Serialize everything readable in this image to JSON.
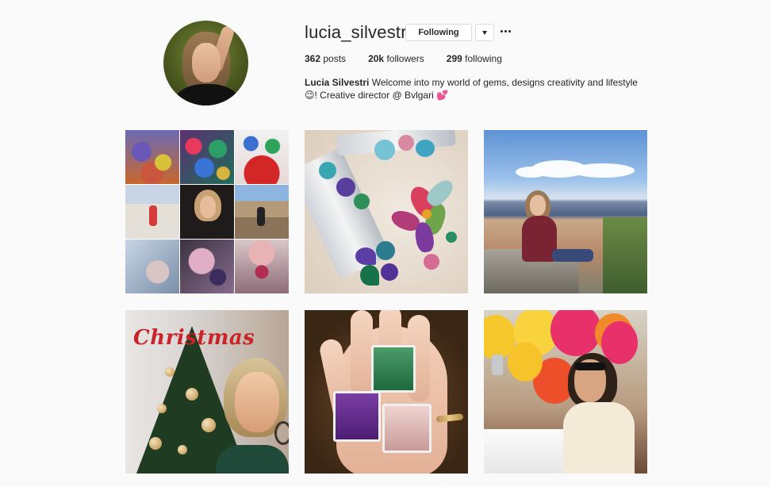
{
  "profile": {
    "username": "lucia_silvestri",
    "follow_label": "Following",
    "stats": {
      "posts_count": "362",
      "posts_label": "posts",
      "followers_count": "20k",
      "followers_label": "followers",
      "following_count": "299",
      "following_label": "following"
    },
    "bio": {
      "name": "Lucia Silvestri",
      "text_line1": "Welcome into my world of gems, designs creativity and lifestyle",
      "text_line2": "😉! Creative director @ Bvlgari 💕"
    }
  },
  "posts": [
    {
      "caption_text": ""
    },
    {
      "caption_text": ""
    },
    {
      "caption_text": ""
    },
    {
      "caption_text": "Christmas"
    },
    {
      "caption_text": ""
    },
    {
      "caption_text": ""
    }
  ],
  "icons": {
    "dropdown": "chevron-down-icon",
    "more": "more-options-icon"
  },
  "colors": {
    "background": "#fafafa",
    "text": "#262626",
    "border": "#dbdbdb"
  }
}
